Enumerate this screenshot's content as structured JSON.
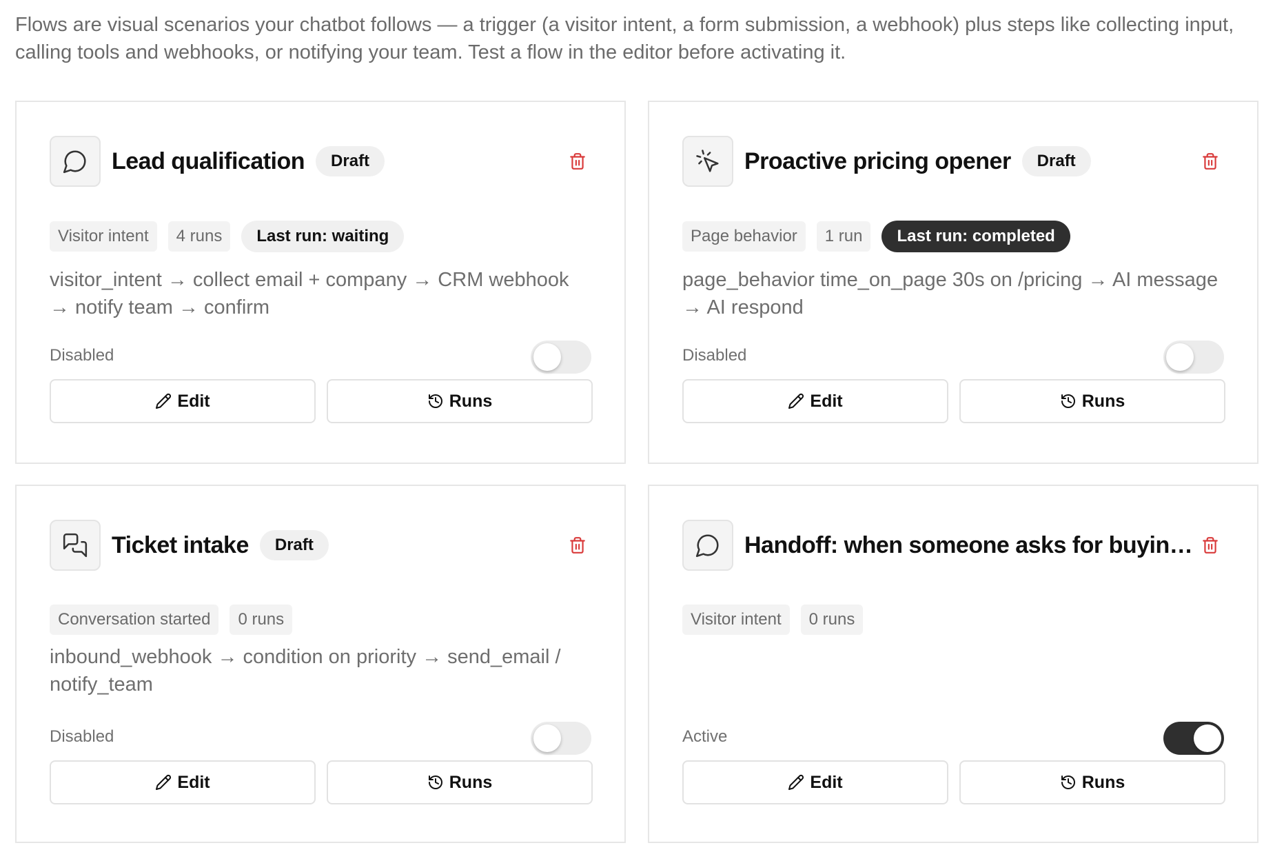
{
  "intro": "Flows are visual scenarios your chatbot follows — a trigger (a visitor intent, a form submission, a webhook) plus steps like collecting input, calling tools and webhooks, or notifying your team. Test a flow in the editor before activating it.",
  "flows": [
    {
      "icon": "chat-bubble-icon",
      "title": "Lead qualification",
      "badge": "Draft",
      "trigger": "Visitor intent",
      "runs": "4 runs",
      "last_run": "Last run: waiting",
      "description": "visitor_intent → collect email + company → CRM webhook → notify team → confirm",
      "status": "Disabled",
      "enabled": false,
      "edit_label": "Edit",
      "runs_label": "Runs"
    },
    {
      "icon": "cursor-click-icon",
      "title": "Proactive pricing opener",
      "badge": "Draft",
      "trigger": "Page behavior",
      "runs": "1 run",
      "last_run": "Last run: completed",
      "description": "page_behavior time_on_page 30s on /pricing → AI message → AI respond",
      "status": "Disabled",
      "enabled": false,
      "edit_label": "Edit",
      "runs_label": "Runs"
    },
    {
      "icon": "chat-bubbles-icon",
      "title": "Ticket intake",
      "badge": "Draft",
      "trigger": "Conversation started",
      "runs": "0 runs",
      "description": "inbound_webhook → condition on priority → send_email / notify_team",
      "status": "Disabled",
      "enabled": false,
      "edit_label": "Edit",
      "runs_label": "Runs"
    },
    {
      "icon": "chat-bubble-icon",
      "title": "Handoff: when someone asks for buying...",
      "trigger": "Visitor intent",
      "runs": "0 runs",
      "status": "Active",
      "enabled": true,
      "edit_label": "Edit",
      "runs_label": "Runs"
    }
  ],
  "colors": {
    "trash": "#d93a3a",
    "toggle_on": "#2f2f2f",
    "toggle_off": "#ececec",
    "last_run_completed_bg": "#2f2f2f"
  }
}
